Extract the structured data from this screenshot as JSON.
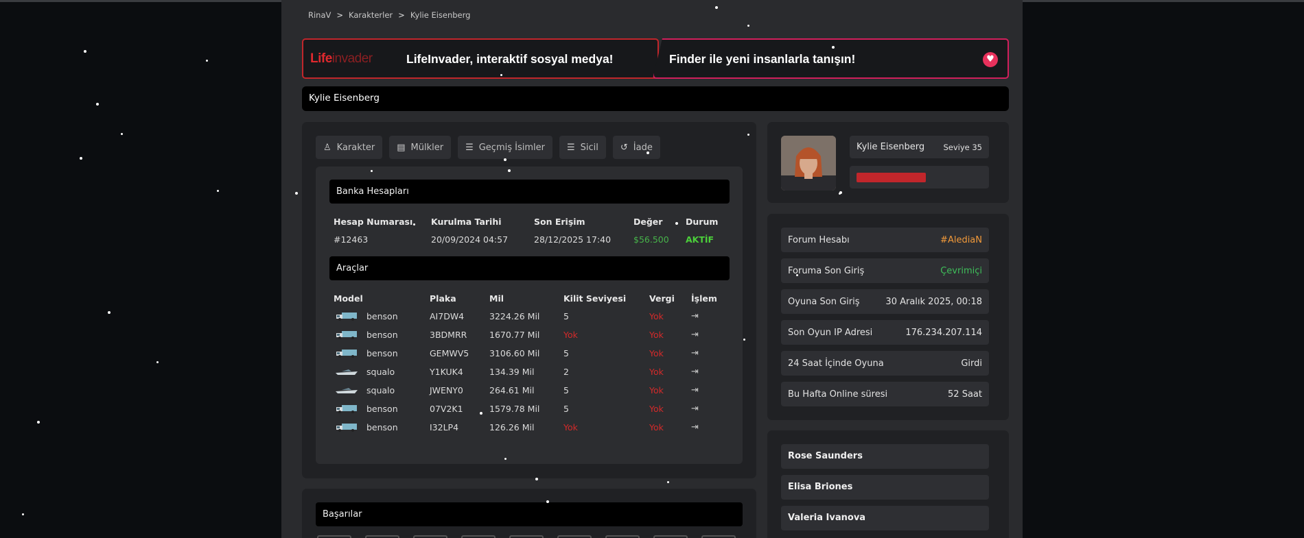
{
  "breadcrumb": [
    "RinaV",
    "Karakterler",
    "Kylie Eisenberg"
  ],
  "banners": {
    "left": {
      "logo_life": "Life",
      "logo_invader": "invader",
      "text": "LifeInvader, interaktif sosyal medya!"
    },
    "right": {
      "text": "Finder ile yeni insanlarla tanışın!",
      "icon": "heart-icon"
    }
  },
  "character_name": "Kylie Eisenberg",
  "tabs": [
    {
      "label": "Karakter",
      "icon": "user-icon"
    },
    {
      "label": "Mülkler",
      "icon": "document-icon"
    },
    {
      "label": "Geçmiş İsimler",
      "icon": "list-icon"
    },
    {
      "label": "Sicil",
      "icon": "list-icon"
    },
    {
      "label": "İade",
      "icon": "undo-icon"
    }
  ],
  "bank": {
    "title": "Banka Hesapları",
    "headers": [
      "Hesap Numarası",
      "Kurulma Tarihi",
      "Son Erişim",
      "Değer",
      "Durum"
    ],
    "row": {
      "number": "#12463",
      "created": "20/09/2024 04:57",
      "last_access": "28/12/2025 17:40",
      "value": "$56.500",
      "status": "AKTİF"
    }
  },
  "vehicles": {
    "title": "Araçlar",
    "headers": [
      "Model",
      "Plaka",
      "Mil",
      "Kilit Seviyesi",
      "Vergi",
      "İşlem"
    ],
    "rows": [
      {
        "model": "benson",
        "plate": "AI7DW4",
        "mil": "3224.26 Mil",
        "lock": "5",
        "tax": "Yok"
      },
      {
        "model": "benson",
        "plate": "3BDMRR",
        "mil": "1670.77 Mil",
        "lock": "Yok",
        "tax": "Yok"
      },
      {
        "model": "benson",
        "plate": "GEMWV5",
        "mil": "3106.60 Mil",
        "lock": "5",
        "tax": "Yok"
      },
      {
        "model": "squalo",
        "plate": "Y1KUK4",
        "mil": "134.39 Mil",
        "lock": "2",
        "tax": "Yok"
      },
      {
        "model": "squalo",
        "plate": "JWENY0",
        "mil": "264.61 Mil",
        "lock": "5",
        "tax": "Yok"
      },
      {
        "model": "benson",
        "plate": "07V2K1",
        "mil": "1579.78 Mil",
        "lock": "5",
        "tax": "Yok"
      },
      {
        "model": "benson",
        "plate": "I32LP4",
        "mil": "126.26 Mil",
        "lock": "Yok",
        "tax": "Yok"
      }
    ]
  },
  "achievements_title": "Başarılar",
  "profile": {
    "name": "Kylie Eisenberg",
    "level": "Seviye 35",
    "health_fraction": 0.55
  },
  "info": [
    {
      "label": "Forum Hesabı",
      "value": "#AlediaN"
    },
    {
      "label": "Foruma Son Giriş",
      "value": "Çevrimiçi"
    },
    {
      "label": "Oyuna Son Giriş",
      "value": "30 Aralık 2025, 00:18"
    },
    {
      "label": "Son Oyun IP Adresi",
      "value": "176.234.207.114"
    },
    {
      "label": "24 Saat İçinde Oyuna",
      "value": "Girdi"
    },
    {
      "label": "Bu Hafta Online süresi",
      "value": "52 Saat"
    }
  ],
  "related_characters": [
    "Rose Saunders",
    "Elisa Briones",
    "Valeria Ivanova"
  ],
  "colors": {
    "accent_red": "#c1262b",
    "accent_pink": "#d21f5c",
    "success": "#4bcf3a",
    "danger": "#d42a2a",
    "forum": "#f29a3a"
  }
}
